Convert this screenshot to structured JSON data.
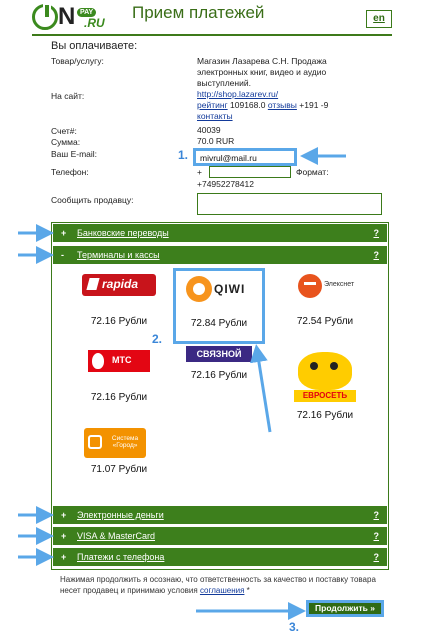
{
  "header": {
    "logo": {
      "n": "N",
      "pay": "PAY",
      "ru": ".RU"
    },
    "title": "Прием платежей",
    "lang": "en"
  },
  "order": {
    "heading": "Вы оплачиваете:",
    "product_label": "Товар/услугу:",
    "product_value": "Магазин Лазарева С.Н. Продажа электронных книг, видео и аудио выступлений.",
    "site_label": "На сайт:",
    "site_url": "http://shop.lazarev.ru/",
    "rating_label": "рейтинг",
    "rating_value": "109168.0",
    "reviews_label": "отзывы",
    "reviews_value": "+191 -9",
    "contacts_label": "контакты",
    "invoice_label": "Счет#:",
    "invoice_value": "40039",
    "sum_label": "Сумма:",
    "sum_value": "70.0 RUR",
    "email_label": "Ваш E-mail:",
    "email_value": "mivrul@mail.ru",
    "phone_label": "Телефон:",
    "phone_plus": "+",
    "phone_format_label": "Формат:",
    "phone_format": "+74952278412",
    "message_label": "Сообщить продавцу:"
  },
  "accordion": {
    "bank": {
      "sign": "+",
      "title": "Банковские переводы",
      "help": "?"
    },
    "terminals": {
      "sign": "-",
      "title": "Терминалы и кассы",
      "help": "?"
    },
    "emoney": {
      "sign": "+",
      "title": "Электронные деньги",
      "help": "?"
    },
    "cards": {
      "sign": "+",
      "title": "VISA & MasterCard",
      "help": "?"
    },
    "phone": {
      "sign": "+",
      "title": "Платежи с телефона",
      "help": "?"
    }
  },
  "payment_methods": [
    {
      "name": "Rapida",
      "logo_text": "rapida",
      "price": "72.16 Рубли"
    },
    {
      "name": "QIWI",
      "logo_text": "QIWI",
      "price": "72.84 Рубли"
    },
    {
      "name": "Элекснет",
      "logo_text": "Элекснет",
      "price": "72.54 Рубли"
    },
    {
      "name": "МТС",
      "logo_text": "МТС",
      "price": "72.16 Рубли"
    },
    {
      "name": "Связной",
      "logo_text": "СВЯЗНОЙ",
      "price": "72.16 Рубли"
    },
    {
      "name": "Евросеть",
      "logo_text": "ЕВРОСЕТЬ",
      "price": "72.16 Рубли"
    },
    {
      "name": "Система Город",
      "logo_text": "Система «Город»",
      "price": "71.07 Рубли"
    }
  ],
  "annotations": {
    "step1": "1.",
    "step2": "2.",
    "step3": "3."
  },
  "footer": {
    "note": "Нажимая продолжить я осознаю, что ответственность за качество и поставку товара несет продавец и принимаю условия",
    "terms_link": "соглашения",
    "asterisk": "*",
    "continue": "Продолжить »"
  },
  "colors": {
    "accent_green": "#3d7f1c",
    "annotation_blue": "#5aa7e8",
    "link_blue": "#123a9a"
  }
}
